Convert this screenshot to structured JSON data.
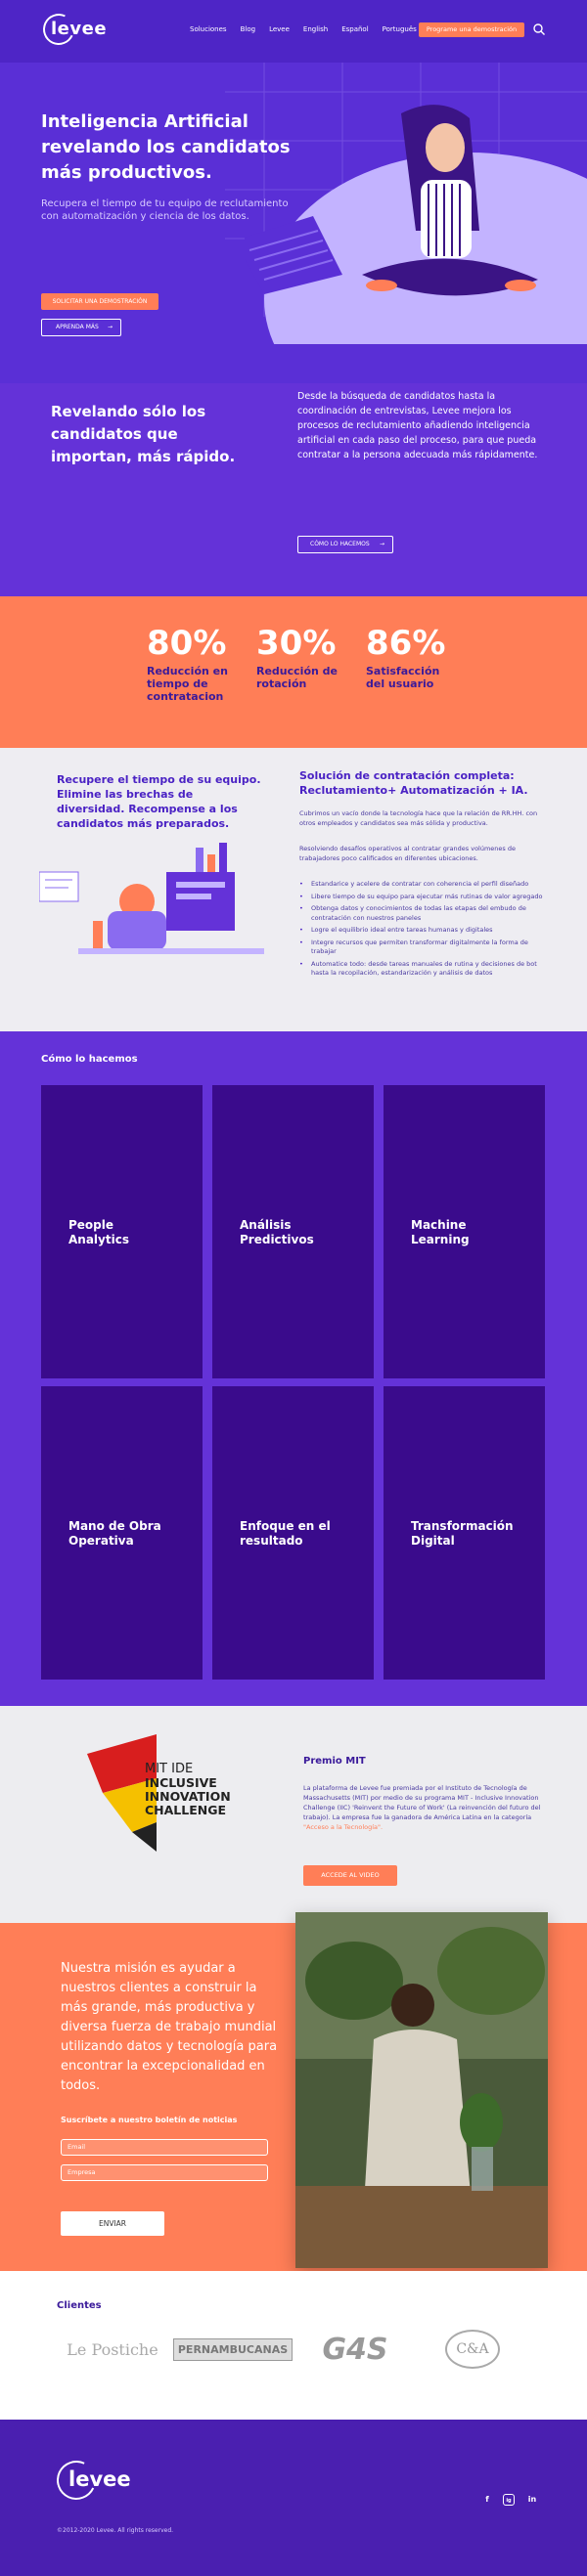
{
  "header": {
    "logo_text": "levee",
    "nav": [
      "Soluciones",
      "Blog",
      "Levee",
      "English",
      "Español",
      "Português"
    ],
    "cta": "Programe una demostración"
  },
  "hero": {
    "title": "Inteligencia Artificial revelando los candidatos más productivos.",
    "subtitle": "Recupera el tiempo de tu equipo de reclutamiento con automatización y ciencia de los datos.",
    "button_primary": "SOLICITAR UNA DEMOSTRACIÓN",
    "button_secondary": "APRENDA MÁS"
  },
  "reveal": {
    "title": "Revelando sólo los candidatos que importan, más rápido.",
    "text": "Desde la búsqueda de candidatos hasta la coordinación de entrevistas, Levee mejora los procesos de reclutamiento añadiendo inteligencia artificial en cada paso del proceso, para que pueda contratar a la persona adecuada más rápidamente.",
    "button": "CÓMO LO HACEMOS"
  },
  "stats": [
    {
      "value": "80%",
      "label": "Reducción en tiempo de contratacion"
    },
    {
      "value": "30%",
      "label": "Reducción de rotación"
    },
    {
      "value": "86%",
      "label": "Satisfacción del usuario"
    }
  ],
  "solution": {
    "left_text": "Recupere el tiempo de su equipo. Elimine las brechas de diversidad. Recompense a los candidatos más preparados.",
    "title": "Solución de contratación completa: Reclutamiento+ Automatización + IA.",
    "p1": "Cubrimos un vacío donde la tecnología hace que la relación de RR.HH. con otros empleados y candidatos sea más sólida y productiva.",
    "p2": "Resolviendo desafíos operativos al contratar grandes volúmenes de trabajadores poco calificados en diferentes ubicaciones.",
    "bullets": [
      "Estandarice y acelere de contratar con coherencia el perfil diseñado",
      "Libere tiempo de su equipo para ejecutar más rutinas de valor agregado",
      "Obtenga datos y conocimientos de todas las etapas del embudo de contratación con nuestros paneles",
      "Logre el equilibrio ideal entre tareas humanas y digitales",
      "Integre recursos que permiten transformar digitalmente la forma de trabajar",
      "Automatice todo: desde tareas manuales de rutina y decisiones de bot hasta la recopilación, estandarización y análisis de datos"
    ]
  },
  "how": {
    "title": "Cómo lo hacemos",
    "cards": [
      "People Analytics",
      "Análisis Predictivos",
      "Machine Learning",
      "Mano de Obra Operativa",
      "Enfoque en el resultado",
      "Transformación Digital"
    ]
  },
  "mit": {
    "logo_line1": "MIT IDE",
    "logo_line2": "INCLUSIVE",
    "logo_line3": "INNOVATION",
    "logo_line4": "CHALLENGE",
    "title": "Premio MIT",
    "text": "La plataforma de Levee fue premiada por el Instituto de Tecnología de Massachusetts (MIT) por medio de su programa MIT - Inclusive Innovation Challenge (IIC) 'Reinvent the Future of Work' (La reinvención del futuro del trabajo). La empresa fue la ganadora de América Latina en la categoría",
    "highlight": "\"Acceso a la Tecnología\".",
    "button": "ACCEDE AL VIDEO"
  },
  "mission": {
    "text": "Nuestra misión es ayudar a nuestros clientes a construir la más grande, más productiva y diversa fuerza de trabajo mundial utilizando datos y tecnología para encontrar la excepcionalidad en todos.",
    "newsletter": "Suscríbete a nuestro boletín de noticias",
    "email_placeholder": "Email",
    "company_placeholder": "Empresa",
    "button": "ENVIAR"
  },
  "clients": {
    "title": "Clientes",
    "logos": [
      "Le Postiche",
      "PERNAMBUCANAS",
      "G4S",
      "C&A"
    ]
  },
  "footer": {
    "logo_text": "levee",
    "copyright": "©2012-2020 Levee. All rights reserved.",
    "social": [
      "f",
      "ig",
      "in"
    ]
  },
  "colors": {
    "purple": "#5a2fd6",
    "dark_purple": "#3a0b8c",
    "orange": "#ff7e57",
    "light_gray": "#eeedf2"
  }
}
